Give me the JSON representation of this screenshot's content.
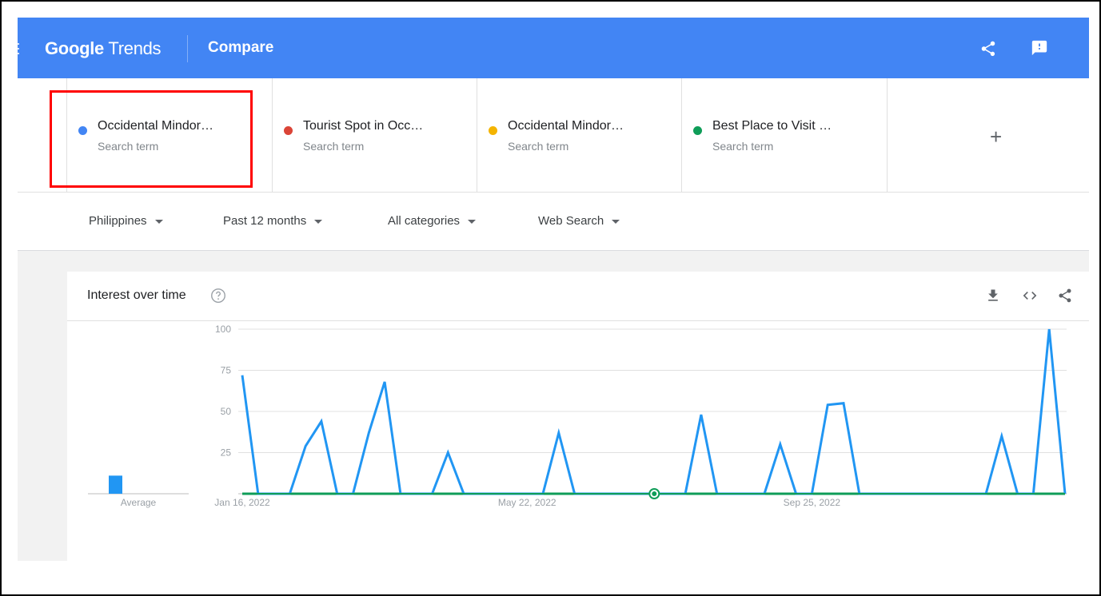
{
  "header": {
    "logo_google": "Google",
    "logo_trends": "Trends",
    "title": "Compare",
    "share_icon": "share-icon",
    "feedback_icon": "feedback-icon",
    "color": "#4285f4"
  },
  "terms": [
    {
      "name": "Occidental Mindor…",
      "sub": "Search term",
      "color": "#4285f4"
    },
    {
      "name": "Tourist Spot in Occ…",
      "sub": "Search term",
      "color": "#db4437"
    },
    {
      "name": "Occidental Mindor…",
      "sub": "Search term",
      "color": "#f4b400"
    },
    {
      "name": "Best Place to Visit …",
      "sub": "Search term",
      "color": "#0f9d58"
    }
  ],
  "add_term_label": "+",
  "filters": {
    "region": "Philippines",
    "time": "Past 12 months",
    "category": "All categories",
    "search_type": "Web Search"
  },
  "card": {
    "title": "Interest over time",
    "help_icon": "help-circle-icon",
    "download_icon": "download-icon",
    "embed_icon": "embed-icon",
    "share_icon": "share-icon"
  },
  "chart_data": {
    "type": "line",
    "ylim": [
      0,
      100
    ],
    "yticks": [
      "100",
      "75",
      "50",
      "25"
    ],
    "x_tick_labels": [
      {
        "label": "Jan 16, 2022",
        "week": 0
      },
      {
        "label": "May 22, 2022",
        "week": 18
      },
      {
        "label": "Sep 25, 2022",
        "week": 36
      }
    ],
    "average_label": "Average",
    "averages": [
      {
        "value": 11,
        "color": "#2196f3"
      }
    ],
    "series": [
      {
        "color": "#2196f3",
        "values": [
          72,
          0,
          0,
          0,
          29,
          44,
          0,
          0,
          37,
          68,
          0,
          0,
          0,
          25,
          0,
          0,
          0,
          0,
          0,
          0,
          37,
          0,
          0,
          0,
          0,
          0,
          0,
          0,
          0,
          48,
          0,
          0,
          0,
          0,
          30,
          0,
          0,
          54,
          55,
          0,
          0,
          0,
          0,
          0,
          0,
          0,
          0,
          0,
          35,
          0,
          0,
          100,
          0
        ]
      },
      {
        "color": "#0f9d58",
        "values": [
          0,
          0,
          0,
          0,
          0,
          0,
          0,
          0,
          0,
          0,
          0,
          0,
          0,
          0,
          0,
          0,
          0,
          0,
          0,
          0,
          0,
          0,
          0,
          0,
          0,
          0,
          0,
          0,
          0,
          0,
          0,
          0,
          0,
          0,
          0,
          0,
          0,
          0,
          0,
          0,
          0,
          0,
          0,
          0,
          0,
          0,
          0,
          0,
          0,
          0,
          0,
          0,
          0
        ]
      }
    ]
  }
}
